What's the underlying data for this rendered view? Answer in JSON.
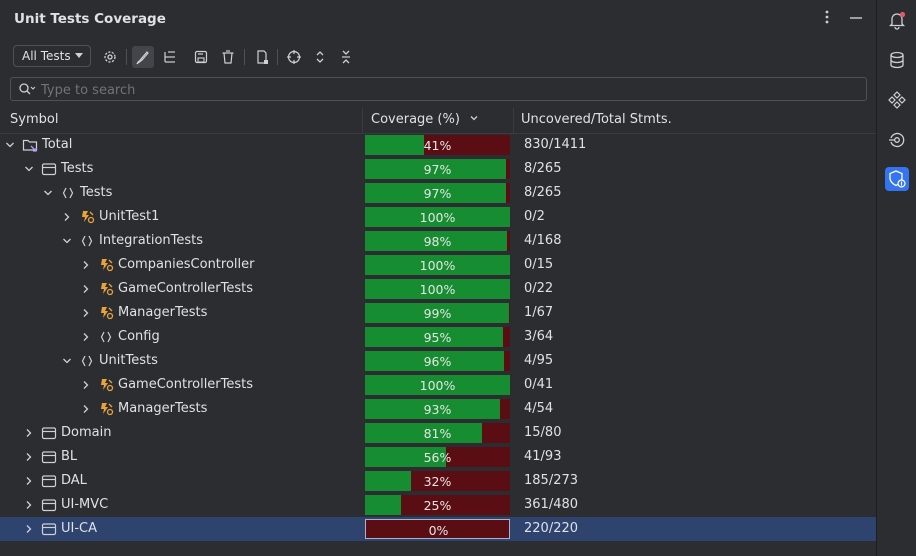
{
  "window": {
    "title": "Unit Tests Coverage"
  },
  "toolbar": {
    "filter_value": "All Tests"
  },
  "search": {
    "placeholder": "Type to search"
  },
  "columns": {
    "symbol": "Symbol",
    "coverage": "Coverage (%)",
    "uncovered": "Uncovered/Total Stmts."
  },
  "colors": {
    "covered": "#168d30",
    "uncovered": "#5a0d13",
    "selection": "#2e436e",
    "accent": "#3574f0"
  },
  "rows": [
    {
      "label": "Total",
      "depth": 0,
      "expanded": true,
      "icon": "total-folder-icon",
      "coverage": 41,
      "coverage_text": "41%",
      "stmts": "830/1411"
    },
    {
      "label": "Tests",
      "depth": 1,
      "expanded": true,
      "icon": "module-icon",
      "coverage": 97,
      "coverage_text": "97%",
      "stmts": "8/265"
    },
    {
      "label": "Tests",
      "depth": 2,
      "expanded": true,
      "icon": "namespace-icon",
      "coverage": 97,
      "coverage_text": "97%",
      "stmts": "8/265"
    },
    {
      "label": "UnitTest1",
      "depth": 3,
      "expanded": false,
      "icon": "test-class-icon",
      "coverage": 100,
      "coverage_text": "100%",
      "stmts": "0/2"
    },
    {
      "label": "IntegrationTests",
      "depth": 3,
      "expanded": true,
      "icon": "namespace-icon",
      "coverage": 98,
      "coverage_text": "98%",
      "stmts": "4/168"
    },
    {
      "label": "CompaniesController",
      "depth": 4,
      "expanded": false,
      "icon": "test-class-icon",
      "coverage": 100,
      "coverage_text": "100%",
      "stmts": "0/15"
    },
    {
      "label": "GameControllerTests",
      "depth": 4,
      "expanded": false,
      "icon": "test-class-icon",
      "coverage": 100,
      "coverage_text": "100%",
      "stmts": "0/22"
    },
    {
      "label": "ManagerTests",
      "depth": 4,
      "expanded": false,
      "icon": "test-class-icon",
      "coverage": 99,
      "coverage_text": "99%",
      "stmts": "1/67"
    },
    {
      "label": "Config",
      "depth": 4,
      "expanded": false,
      "icon": "namespace-icon",
      "coverage": 95,
      "coverage_text": "95%",
      "stmts": "3/64"
    },
    {
      "label": "UnitTests",
      "depth": 3,
      "expanded": true,
      "icon": "namespace-icon",
      "coverage": 96,
      "coverage_text": "96%",
      "stmts": "4/95"
    },
    {
      "label": "GameControllerTests",
      "depth": 4,
      "expanded": false,
      "icon": "test-class-icon",
      "coverage": 100,
      "coverage_text": "100%",
      "stmts": "0/41"
    },
    {
      "label": "ManagerTests",
      "depth": 4,
      "expanded": false,
      "icon": "test-class-icon",
      "coverage": 93,
      "coverage_text": "93%",
      "stmts": "4/54"
    },
    {
      "label": "Domain",
      "depth": 1,
      "expanded": false,
      "icon": "module-icon",
      "coverage": 81,
      "coverage_text": "81%",
      "stmts": "15/80"
    },
    {
      "label": "BL",
      "depth": 1,
      "expanded": false,
      "icon": "module-icon",
      "coverage": 56,
      "coverage_text": "56%",
      "stmts": "41/93"
    },
    {
      "label": "DAL",
      "depth": 1,
      "expanded": false,
      "icon": "module-icon",
      "coverage": 32,
      "coverage_text": "32%",
      "stmts": "185/273"
    },
    {
      "label": "UI-MVC",
      "depth": 1,
      "expanded": false,
      "icon": "module-icon",
      "coverage": 25,
      "coverage_text": "25%",
      "stmts": "361/480"
    },
    {
      "label": "UI-CA",
      "depth": 1,
      "expanded": false,
      "icon": "module-icon",
      "coverage": 0,
      "coverage_text": "0%",
      "stmts": "220/220",
      "selected": true
    }
  ]
}
